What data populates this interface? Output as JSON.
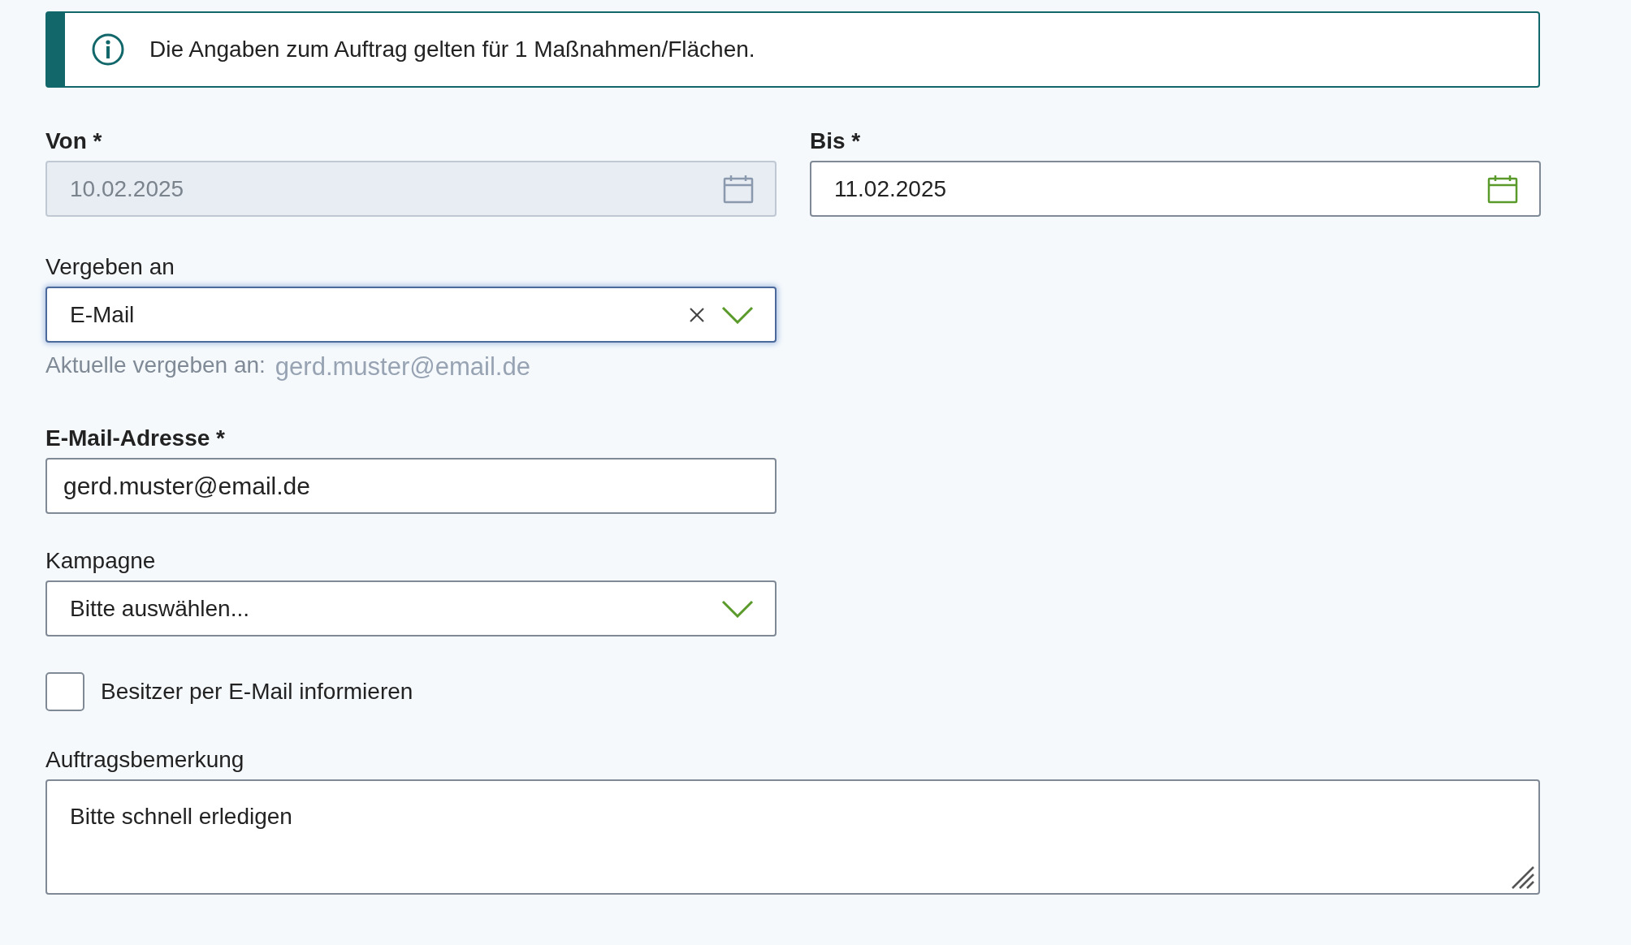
{
  "info_banner": {
    "text": "Die Angaben zum Auftrag gelten für 1 Maßnahmen/Flächen."
  },
  "date_fields": [
    {
      "label": "Von *",
      "value": "10.02.2025",
      "disabled": true
    },
    {
      "label": "Bis *",
      "value": "11.02.2025",
      "disabled": false
    }
  ],
  "assign_field": {
    "label": "Vergeben an",
    "value": "E-Mail",
    "focused": true,
    "current_label": "Aktuelle vergeben an:",
    "current_value": "gerd.muster@email.de"
  },
  "email_field": {
    "label": "E-Mail-Adresse *",
    "value": "gerd.muster@email.de"
  },
  "campaign_field": {
    "label": "Kampagne",
    "placeholder": "Bitte auswählen..."
  },
  "notify_checkbox": {
    "label": "Besitzer per E-Mail informieren",
    "checked": false
  },
  "remark_field": {
    "label": "Auftragsbemerkung",
    "value": "Bitte schnell erledigen"
  }
}
